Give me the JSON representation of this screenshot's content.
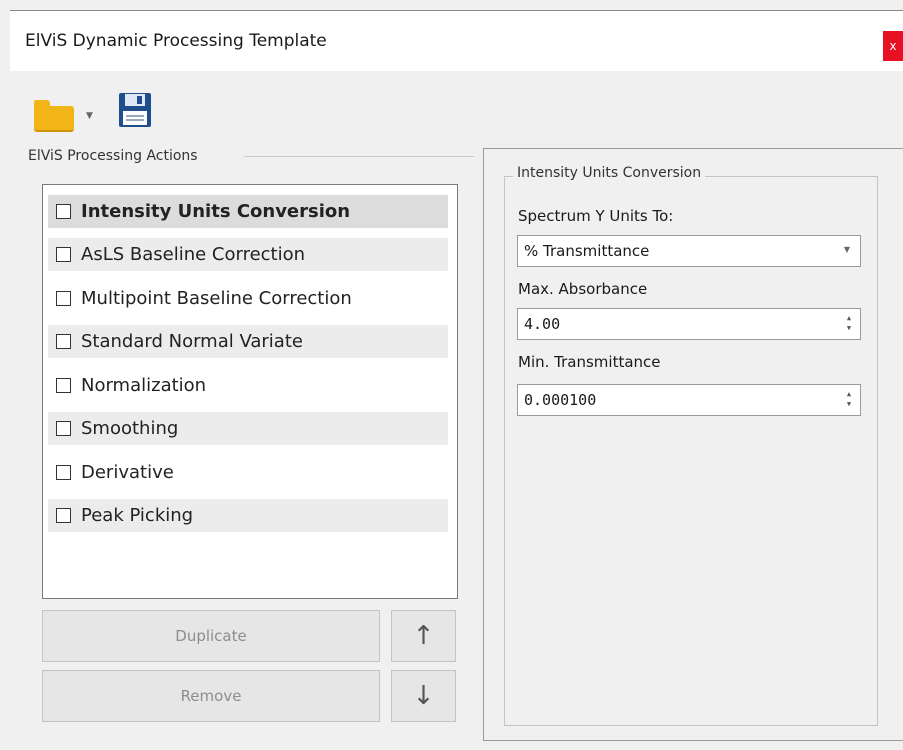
{
  "window": {
    "title": "ElViS Dynamic Processing Template",
    "close_label": "x"
  },
  "toolbar": {
    "open_icon": "folder-open-icon",
    "save_icon": "floppy-save-icon"
  },
  "actions_group": {
    "label": "ElViS Processing Actions",
    "items": [
      {
        "label": "Intensity Units Conversion",
        "checked": false
      },
      {
        "label": "AsLS Baseline Correction",
        "checked": false
      },
      {
        "label": "Multipoint Baseline Correction",
        "checked": false
      },
      {
        "label": "Standard Normal Variate",
        "checked": false
      },
      {
        "label": "Normalization",
        "checked": false
      },
      {
        "label": "Smoothing",
        "checked": false
      },
      {
        "label": "Derivative",
        "checked": false
      },
      {
        "label": "Peak Picking",
        "checked": false
      }
    ],
    "duplicate_label": "Duplicate",
    "remove_label": "Remove",
    "up_glyph": "↑",
    "down_glyph": "↓"
  },
  "settings": {
    "group_label": "Intensity Units Conversion",
    "spectrum_units_label": "Spectrum Y Units To:",
    "spectrum_units_value": "% Transmittance",
    "max_absorbance_label": "Max. Absorbance",
    "max_absorbance_value": "4.00",
    "min_transmittance_label": "Min. Transmittance",
    "min_transmittance_value": "0.000100"
  },
  "colors": {
    "close_button": "#e81123",
    "folder": "#f2b517",
    "save_icon": "#1f4e8c"
  }
}
